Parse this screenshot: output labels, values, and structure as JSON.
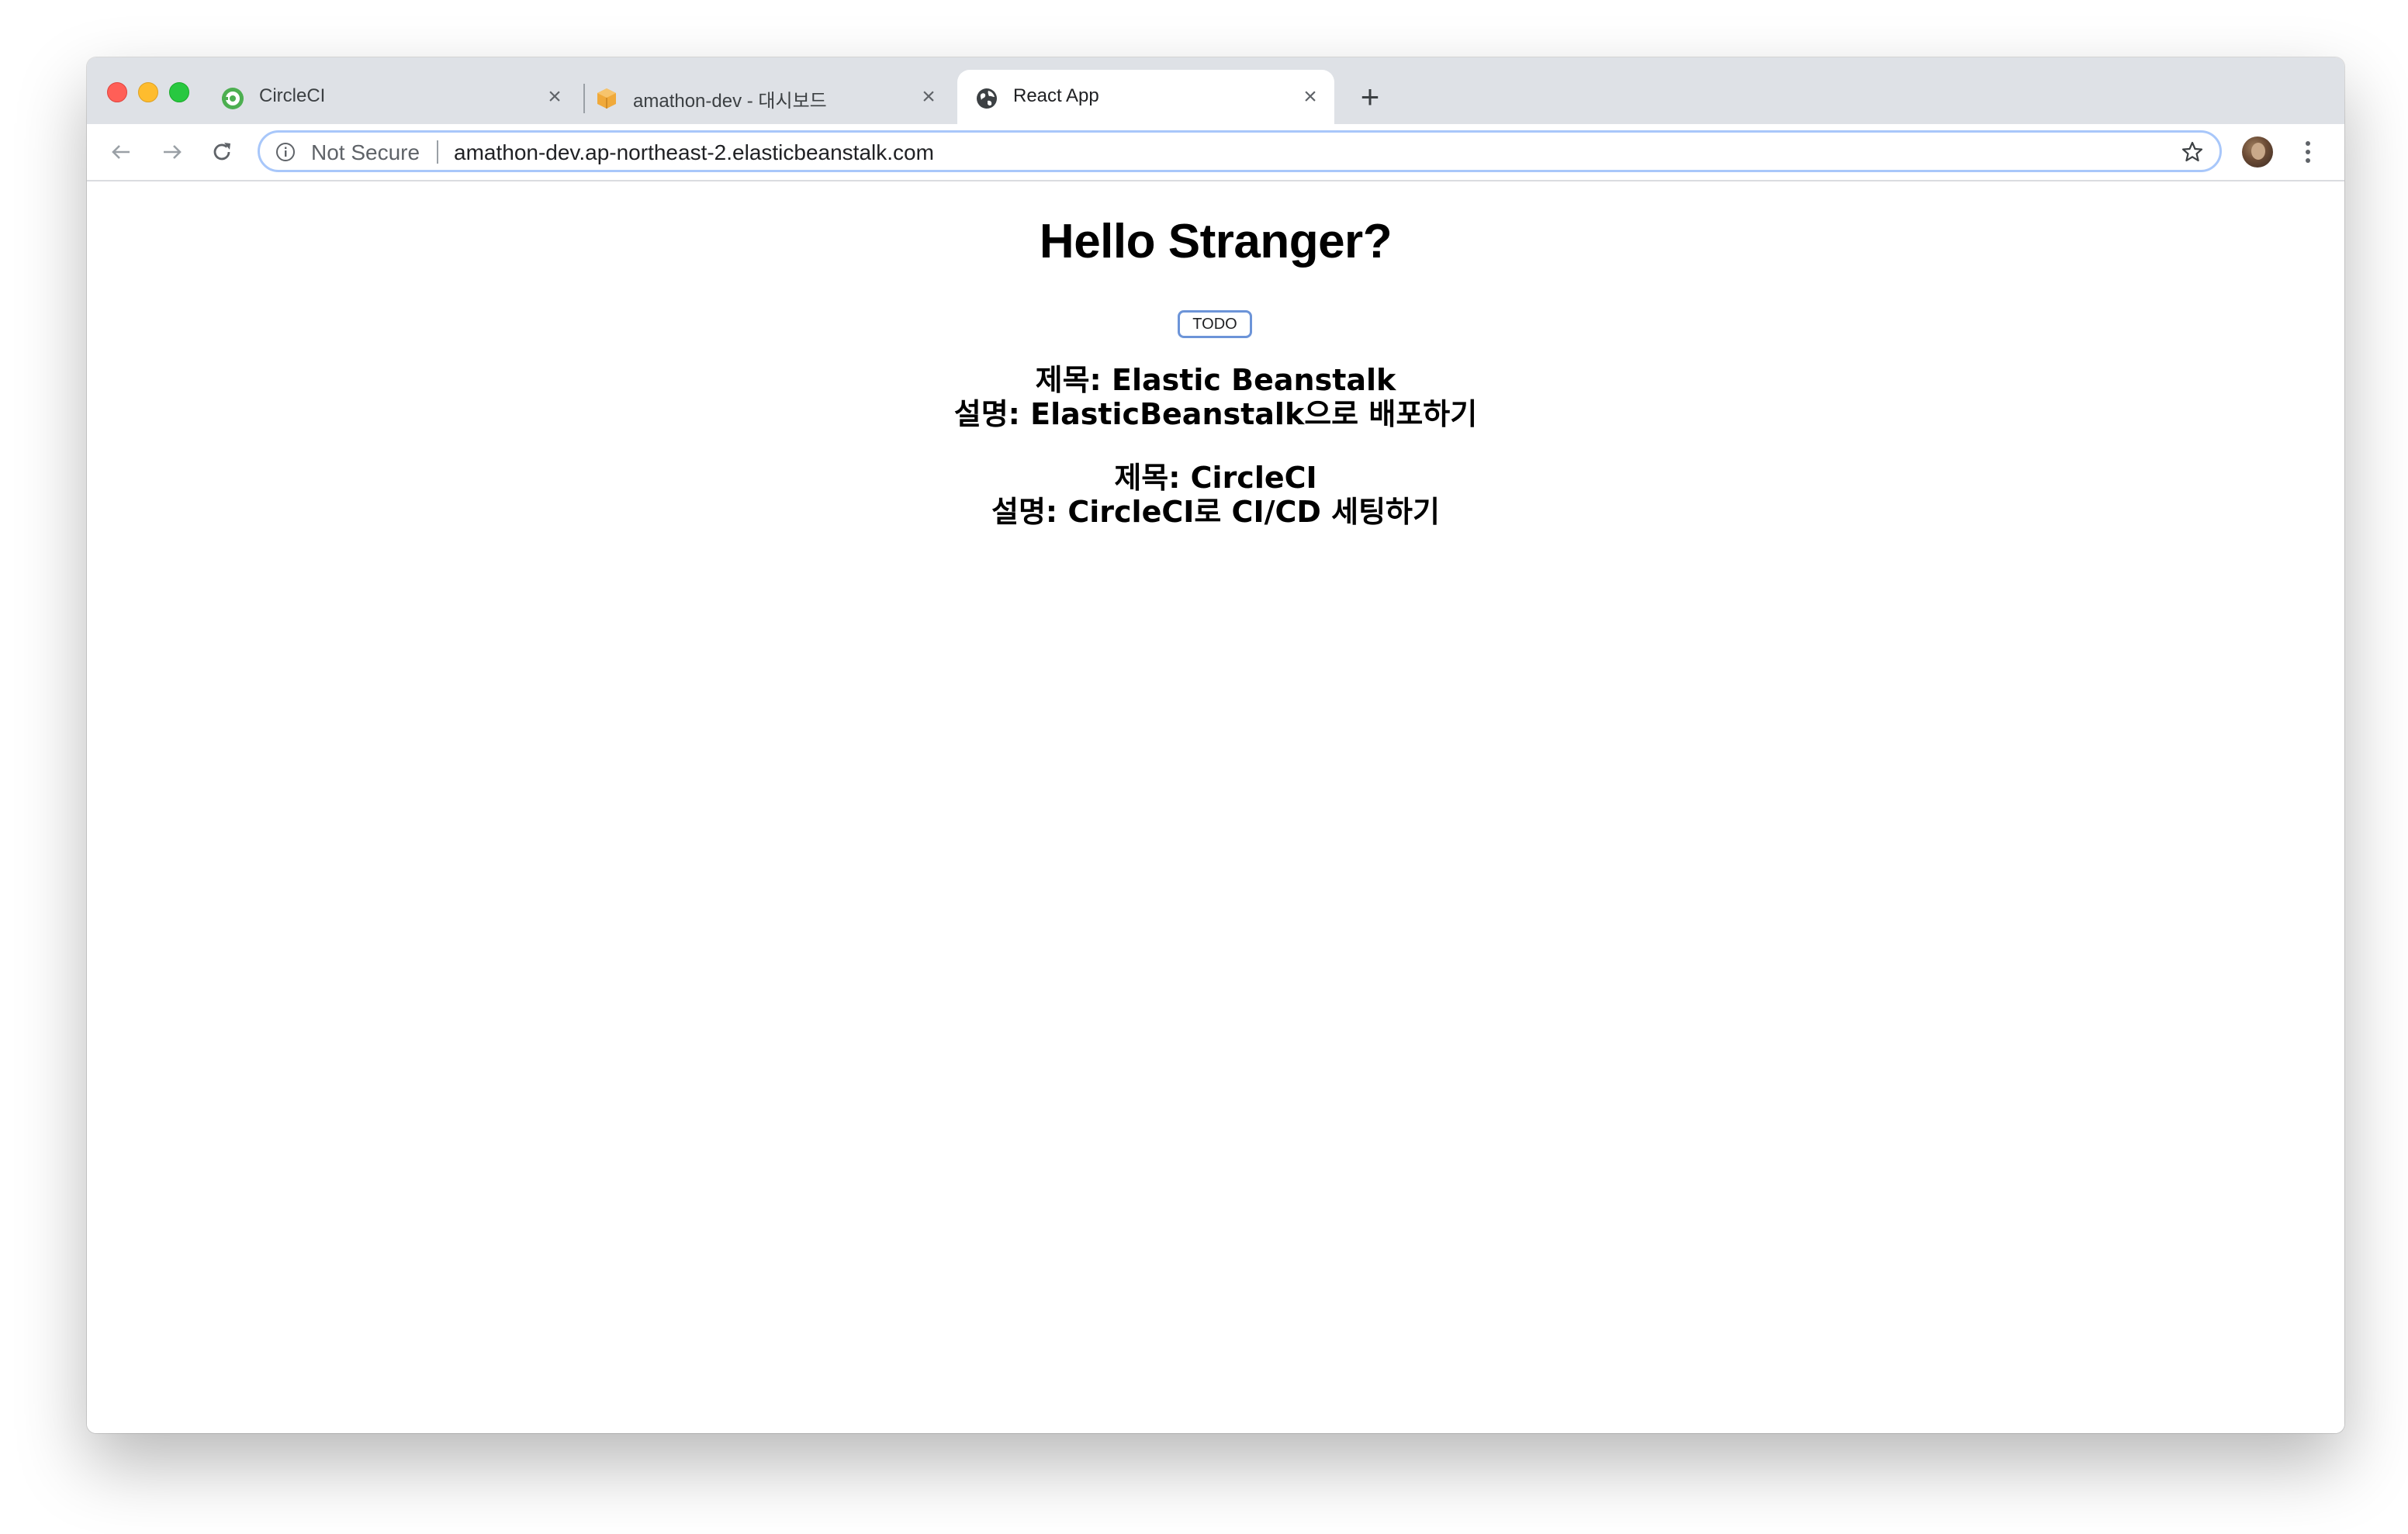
{
  "browser": {
    "tabs": [
      {
        "title": "CircleCI",
        "icon": "circleci-icon",
        "active": false
      },
      {
        "title": "amathon-dev - 대시보드",
        "icon": "aws-box-icon",
        "active": false
      },
      {
        "title": "React App",
        "icon": "globe-icon",
        "active": true
      }
    ],
    "tab_close_glyph": "×",
    "new_tab_glyph": "+",
    "security_label": "Not Secure",
    "url": "amathon-dev.ap-northeast-2.elasticbeanstalk.com"
  },
  "page": {
    "heading": "Hello Stranger?",
    "todo_button_label": "TODO",
    "todos": [
      {
        "title": "제목: Elastic Beanstalk",
        "description": "설명: ElasticBeanstalk으로 배포하기"
      },
      {
        "title": "제목: CircleCI",
        "description": "설명: CircleCI로 CI/CD 세팅하기"
      }
    ]
  },
  "colors": {
    "tabstrip_bg": "#dee1e6",
    "omnibox_border": "#a8c7fa",
    "todo_button_border": "#6c94d8",
    "circleci_green": "#4caf50",
    "aws_orange": "#f0a93a"
  }
}
